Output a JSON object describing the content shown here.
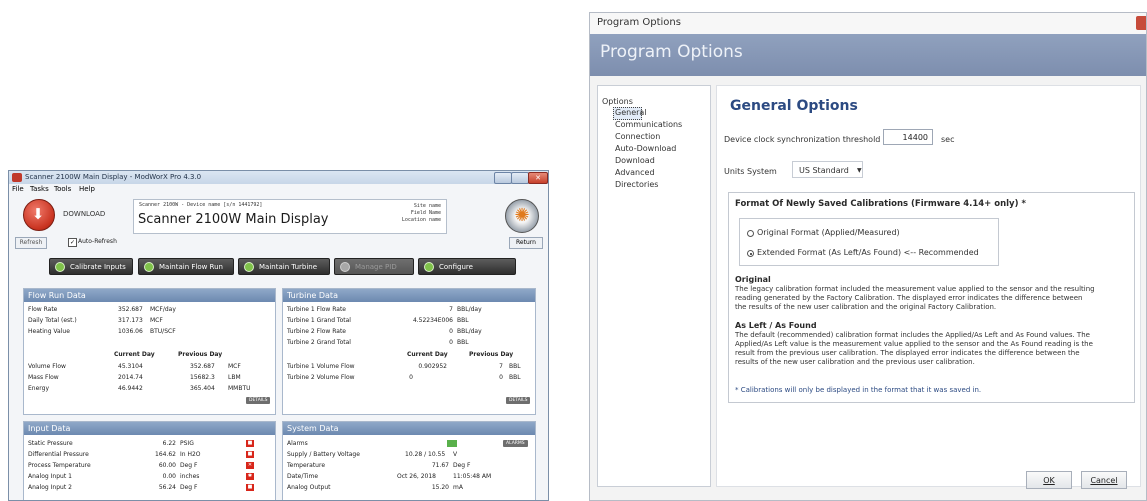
{
  "main_window": {
    "title": "Scanner 2100W Main Display - ModWorX Pro 4.3.0",
    "menu": [
      "File",
      "Tasks",
      "Tools",
      "Help"
    ],
    "download_label": "DOWNLOAD",
    "device_line": "Scanner 2100W - Device name [s/n 1441792]",
    "device_title": "Scanner 2100W Main Display",
    "site_name": "Site name",
    "field_name": "Field Name",
    "location_name": "Location name",
    "refresh_label": "Refresh",
    "auto_refresh_label": "Auto-Refresh",
    "auto_refresh_checked": true,
    "return_label": "Return",
    "actions": [
      {
        "label": "Calibrate Inputs",
        "enabled": true
      },
      {
        "label": "Maintain Flow Run",
        "enabled": true
      },
      {
        "label": "Maintain Turbine",
        "enabled": true
      },
      {
        "label": "Manage PID",
        "enabled": false
      },
      {
        "label": "Configure",
        "enabled": true
      }
    ],
    "flow_run": {
      "title": "Flow Run Data",
      "rows": [
        {
          "label": "Flow Rate",
          "value": "352.687",
          "unit": "MCF/day"
        },
        {
          "label": "Daily Total (est.)",
          "value": "317.173",
          "unit": "MCF"
        },
        {
          "label": "Heating Value",
          "value": "1036.06",
          "unit": "BTU/SCF"
        }
      ],
      "col_current": "Current Day",
      "col_previous": "Previous Day",
      "day_rows": [
        {
          "label": "Volume Flow",
          "current": "45.3104",
          "previous": "352.687",
          "unit": "MCF"
        },
        {
          "label": "Mass Flow",
          "current": "2014.74",
          "previous": "15682.3",
          "unit": "LBM"
        },
        {
          "label": "Energy",
          "current": "46.9442",
          "previous": "365.404",
          "unit": "MMBTU"
        }
      ],
      "details": "DETAILS"
    },
    "turbine": {
      "title": "Turbine Data",
      "rows": [
        {
          "label": "Turbine 1 Flow Rate",
          "value": "7",
          "unit": "BBL/day"
        },
        {
          "label": "Turbine 1 Grand Total",
          "value": "4.52234E006",
          "unit": "BBL"
        },
        {
          "label": "Turbine 2 Flow Rate",
          "value": "0",
          "unit": "BBL/day"
        },
        {
          "label": "Turbine 2 Grand Total",
          "value": "0",
          "unit": "BBL"
        }
      ],
      "col_current": "Current Day",
      "col_previous": "Previous Day",
      "day_rows": [
        {
          "label": "Turbine 1 Volume Flow",
          "current": "0.902952",
          "previous": "7",
          "unit": "BBL"
        },
        {
          "label": "Turbine 2 Volume Flow",
          "current": "0",
          "previous": "0",
          "unit": "BBL"
        }
      ],
      "details": "DETAILS"
    },
    "input_data": {
      "title": "Input Data",
      "rows": [
        {
          "label": "Static Pressure",
          "value": "6.22",
          "unit": "PSIG",
          "alarm": "lock"
        },
        {
          "label": "Differential Pressure",
          "value": "164.62",
          "unit": "In H2O",
          "alarm": "lock"
        },
        {
          "label": "Process Temperature",
          "value": "60.00",
          "unit": "Deg F",
          "alarm": "x"
        },
        {
          "label": "Analog Input 1",
          "value": "0.00",
          "unit": "inches",
          "alarm": "star"
        },
        {
          "label": "Analog Input 2",
          "value": "56.24",
          "unit": "Deg F",
          "alarm": "lock"
        }
      ]
    },
    "system_data": {
      "title": "System Data",
      "alarms_label": "Alarms",
      "alarms_button": "ALARMS",
      "rows": [
        {
          "label": "Supply / Battery Voltage",
          "value": "10.28 / 10.55",
          "unit": "V"
        },
        {
          "label": "Temperature",
          "value": "71.67",
          "unit": "Deg F"
        },
        {
          "label": "Date/Time",
          "value": "Oct 26, 2018",
          "unit": "11:05:48 AM"
        },
        {
          "label": "Analog Output",
          "value": "15.20",
          "unit": "mA"
        }
      ]
    }
  },
  "options_window": {
    "title": "Program Options",
    "banner": "Program Options",
    "tree": [
      "Options",
      "General",
      "Communications",
      "Connection",
      "Auto-Download",
      "Download",
      "Advanced",
      "Directories"
    ],
    "selected": "General",
    "heading": "General Options",
    "sync_label": "Device clock synchronization threshold",
    "sync_value": "14400",
    "sync_unit": "sec",
    "units_label": "Units System",
    "units_value": "US Standard",
    "format_title": "Format Of Newly Saved Calibrations (Firmware 4.14+ only) *",
    "radio_original": "Original Format (Applied/Measured)",
    "radio_extended": "Extended Format (As Left/As Found) <-- Recommended",
    "selected_format": "extended",
    "original_heading": "Original",
    "original_text": [
      "The legacy calibration format included the measurement value applied to the sensor and the resulting",
      "reading generated by the Factory Calibration. The displayed error indicates the difference between",
      "the results of the new user calibration and the original Factory Calibration."
    ],
    "asleft_heading": "As Left / As Found",
    "asleft_text": [
      "The default (recommended) calibration format includes the Applied/As Left  and As Found values.  The",
      "Applied/As Left value is the measurement value applied to the sensor and the As Found reading is the",
      "result from the previous user calibration.  The displayed error indicates the difference between the",
      "results of the new user calibration and the previous user calibration."
    ],
    "note": "* Calibrations will only be displayed in the format that it was saved in.",
    "ok_label": "OK",
    "cancel_label": "Cancel"
  },
  "colors": {
    "panel_header": "#7b95ba",
    "banner": "#8698b6",
    "heading_blue": "#2c4a82",
    "alarm_red": "#d8261a",
    "ok_green": "#59b04b"
  }
}
